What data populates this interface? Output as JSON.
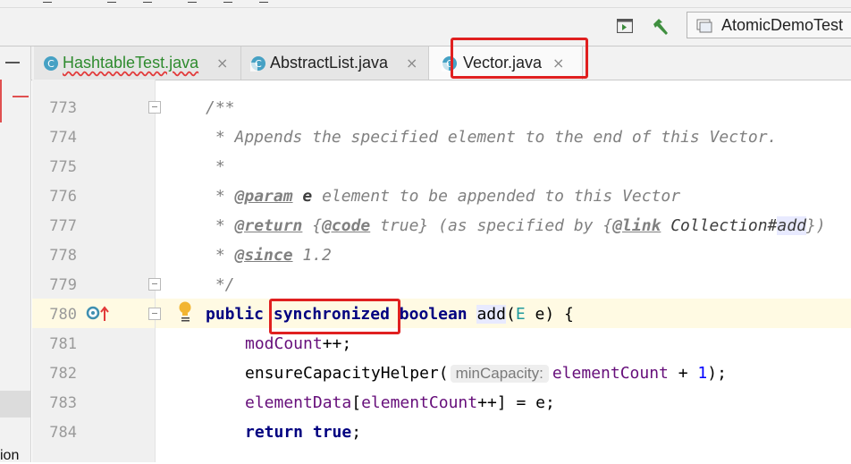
{
  "toolbar": {
    "run_config": "AtomicDemoTest"
  },
  "tabs": [
    {
      "label": "HashtableTest.java",
      "close": "×"
    },
    {
      "label": "AbstractList.java",
      "close": "×"
    },
    {
      "label": "Vector.java",
      "close": "×"
    }
  ],
  "left_panel": {
    "cut_text": "ion"
  },
  "editor": {
    "lines": [
      {
        "num": "773"
      },
      {
        "num": "774"
      },
      {
        "num": "775"
      },
      {
        "num": "776"
      },
      {
        "num": "777"
      },
      {
        "num": "778"
      },
      {
        "num": "779"
      },
      {
        "num": "780"
      },
      {
        "num": "781"
      },
      {
        "num": "782"
      },
      {
        "num": "783"
      },
      {
        "num": "784"
      }
    ],
    "code": {
      "l773": "/**",
      "l774": " * Appends the specified element to the end of this Vector.",
      "l775": " *",
      "l776_star": " * ",
      "l776_tag": "@param",
      "l776_name": " e",
      "l776_rest": " element to be appended to this Vector",
      "l777_star": " * ",
      "l777_tag": "@return",
      "l777_a": " {",
      "l777_code": "@code",
      "l777_b": " true} (as specified by {",
      "l777_link": "@link",
      "l777_c": " Collection#",
      "l777_add": "add",
      "l777_d": "})",
      "l778_star": " * ",
      "l778_tag": "@since",
      "l778_rest": " 1.2",
      "l779": " */",
      "l780_public": "public",
      "l780_sync": "synchronized",
      "l780_bool": "boolean",
      "l780_add": "add",
      "l780_open": "(",
      "l780_E": "E",
      "l780_rest": " e) {",
      "l781_field": "modCount",
      "l781_rest": "++;",
      "l782_a": "ensureCapacityHelper(",
      "l782_hint": "minCapacity:",
      "l782_field": "elementCount",
      "l782_b": " + ",
      "l782_num": "1",
      "l782_c": ");",
      "l783_field1": "elementData",
      "l783_a": "[",
      "l783_field2": "elementCount",
      "l783_b": "++] = e;",
      "l784_ret": "return",
      "l784_true": "true",
      "l784_end": ";"
    }
  },
  "colors": {
    "highlight_box": "#e02020",
    "comment": "#808080",
    "keyword": "#000080",
    "field": "#660e7a",
    "number": "#0000ff"
  },
  "icons": [
    "run-window-icon",
    "build-hammer-icon",
    "class-file-icon",
    "override-method-icon",
    "intention-bulb-icon",
    "fold-icon"
  ]
}
